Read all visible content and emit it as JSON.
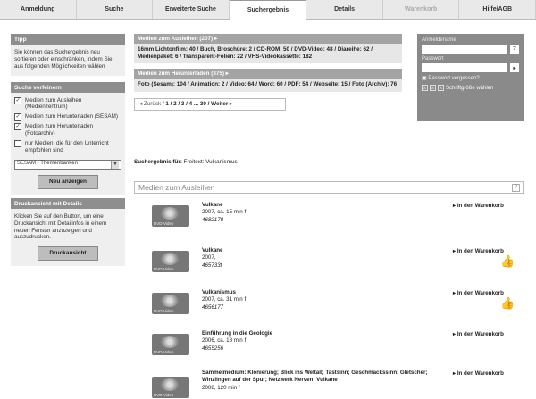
{
  "tabs": [
    {
      "label": "Anmeldung"
    },
    {
      "label": "Suche"
    },
    {
      "label": "Erweiterte Suche"
    },
    {
      "label": "Suchergebnis"
    },
    {
      "label": "Details"
    },
    {
      "label": "Warenkorb"
    },
    {
      "label": "Hilfe/AGB"
    }
  ],
  "sidebar": {
    "tipp_title": "Tipp",
    "tipp_text": "Sie können das Suchergebnis neu sortieren oder einschränken, indem Sie aus folgenden Möglichkeiten wählen",
    "refine_title": "Suche verfeinern",
    "filters": [
      {
        "label": "Medien zum Ausleihen (Medienzentrum)"
      },
      {
        "label": "Medien zum Herunterladen (SESAM)"
      },
      {
        "label": "Medien zum Herunterladen (Fotoarchiv)"
      },
      {
        "label": "nur Medien, die für den Unterricht empfohlen sind"
      }
    ],
    "select_value": "SESAM - Themenbanken",
    "refresh_button": "Neu anzeigen",
    "print_title": "Druckansicht mit Details",
    "print_text": "Klicken Sie auf den Button, um eine Druckansicht mit Detailinfos in einem neuen Fenster anzuzeigen und auszudrucken.",
    "print_button": "Druckansicht"
  },
  "main": {
    "loan_head": "Medien zum Ausleihen (207)",
    "loan_body": "16mm Lichtonfilm: 40 / Buch, Broschüre: 2 / CD-ROM: 50 / DVD-Video: 48 / Diareihe: 62 / Medienpaket: 6 / Transparent-Folien: 22 / VHS-Videokassette: 182",
    "download_head": "Medien zum Herunterladen (375)",
    "download_body": "Foto (Sesam): 104 / Animation: 2 / Video: 64 / Word: 60 / PDF: 54 / Webseite: 15 / Foto (Archiv): 76",
    "pager_back": "◂ Zurück",
    "pager_pages": "/ 1 / 2 / 3 / 4 ... 30 /",
    "pager_next": "Weiter ▸",
    "search_label": "Suchergebnis für:",
    "search_value": "Freitext: Vulkanismus",
    "results_title": "Medien zum Ausleihen",
    "help": "?"
  },
  "results": [
    {
      "title": "Vulkane",
      "meta": "2007, ca. 15 min f",
      "code": "4682178",
      "cart": "▸ In den Warenkorb",
      "recommended": false
    },
    {
      "title": "Vulkane",
      "meta": "2007,",
      "code": "465733f",
      "cart": "▸ In den Warenkorb",
      "recommended": true
    },
    {
      "title": "Vulkanismus",
      "meta": "2007, ca. 31 min f",
      "code": "4656177",
      "cart": "▸ In den Warenkorb",
      "recommended": true
    },
    {
      "title": "Einführung in die Geologie",
      "meta": "2006, ca. 18 min f",
      "code": "4655256",
      "cart": "▸ In den Warenkorb",
      "recommended": false
    },
    {
      "title": "Sammelmedium: Klonierung; Blick ins Weltall; Tastsinn; Geschmackssinn; Gletscher; Winzlingen auf der Spur; Netzwerk Nerven; Vulkane",
      "meta": "2008, 120 min f",
      "code": "",
      "cart": "▸ In den Warenkorb",
      "recommended": false
    }
  ],
  "dvd_label": "DVD-Video",
  "login": {
    "user_label": "Anmeldename",
    "pass_label": "Passwort",
    "help": "?",
    "go": "▸",
    "forgot": "Passwort vergessen?",
    "font_size": "Schriftgröße wählen"
  }
}
